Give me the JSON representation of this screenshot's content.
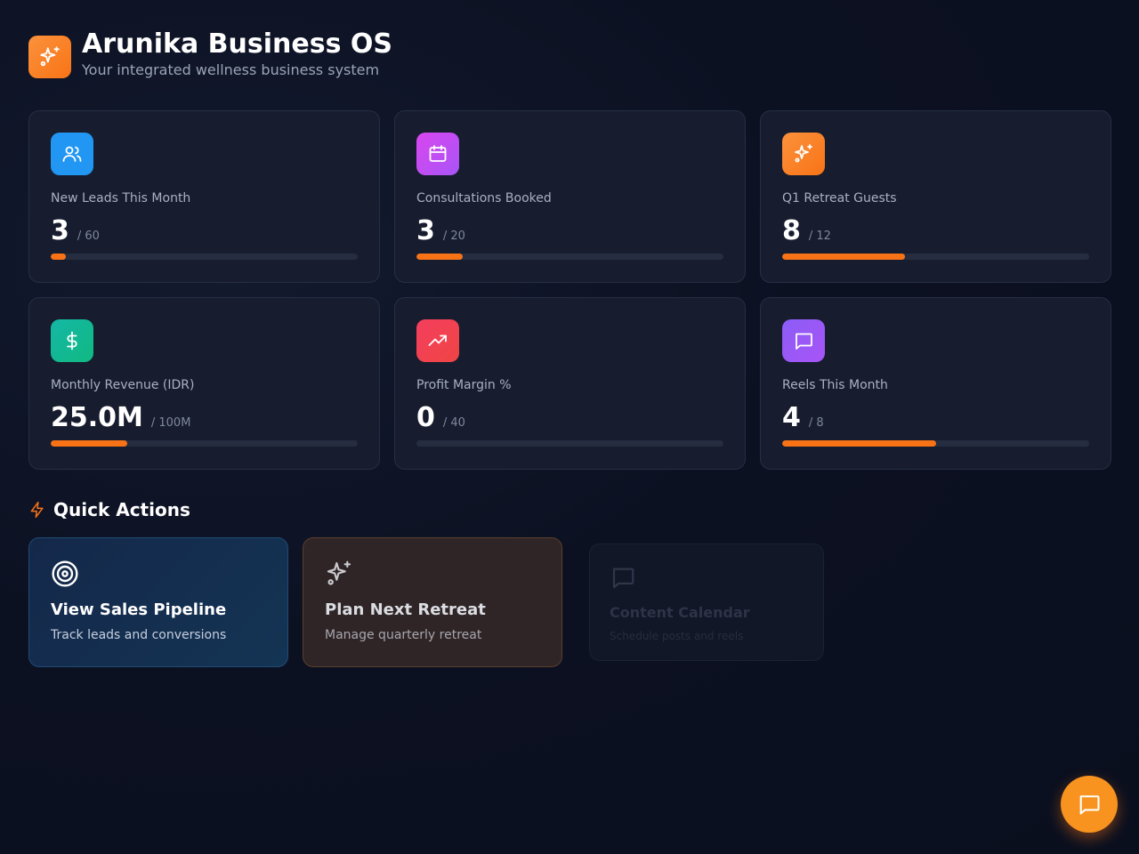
{
  "header": {
    "title": "Arunika Business OS",
    "subtitle": "Your integrated wellness business system",
    "logo_icon": "sparkles-icon",
    "logo_color": "#f97316"
  },
  "stats": [
    {
      "label": "New Leads This Month",
      "value": "3",
      "target": "/ 60",
      "progress": 0.05,
      "icon": "users-icon",
      "color": "#2196f3"
    },
    {
      "label": "Consultations Booked",
      "value": "3",
      "target": "/ 20",
      "progress": 0.15,
      "icon": "calendar-icon",
      "color": "#c04fd6"
    },
    {
      "label": "Q1 Retreat Guests",
      "value": "8",
      "target": "/ 12",
      "progress": 0.4,
      "icon": "sparkles-icon",
      "color": "#f97316"
    },
    {
      "label": "Monthly Revenue (IDR)",
      "value": "25.0M",
      "target": "/ 100M",
      "progress": 0.25,
      "icon": "dollar-icon",
      "color": "#10b981"
    },
    {
      "label": "Profit Margin %",
      "value": "0",
      "target": "/ 40",
      "progress": 0,
      "icon": "trending-up-icon",
      "color": "#ef4444"
    },
    {
      "label": "Reels This Month",
      "value": "4",
      "target": "/ 8",
      "progress": 0.5,
      "icon": "message-square-icon",
      "color": "#a855f7"
    }
  ],
  "quick_actions": {
    "heading": "Quick Actions",
    "heading_icon": "lightning-icon",
    "items": [
      {
        "title": "View Sales Pipeline",
        "description": "Track leads and conversions",
        "icon": "target-icon"
      },
      {
        "title": "Plan Next Retreat",
        "description": "Manage quarterly retreat",
        "icon": "sparkles-icon"
      },
      {
        "title": "Content Calendar",
        "description": "Schedule posts and reels",
        "icon": "message-square-icon"
      }
    ]
  },
  "chat_fab": {
    "icon": "chat-icon",
    "color": "#f7931e"
  }
}
